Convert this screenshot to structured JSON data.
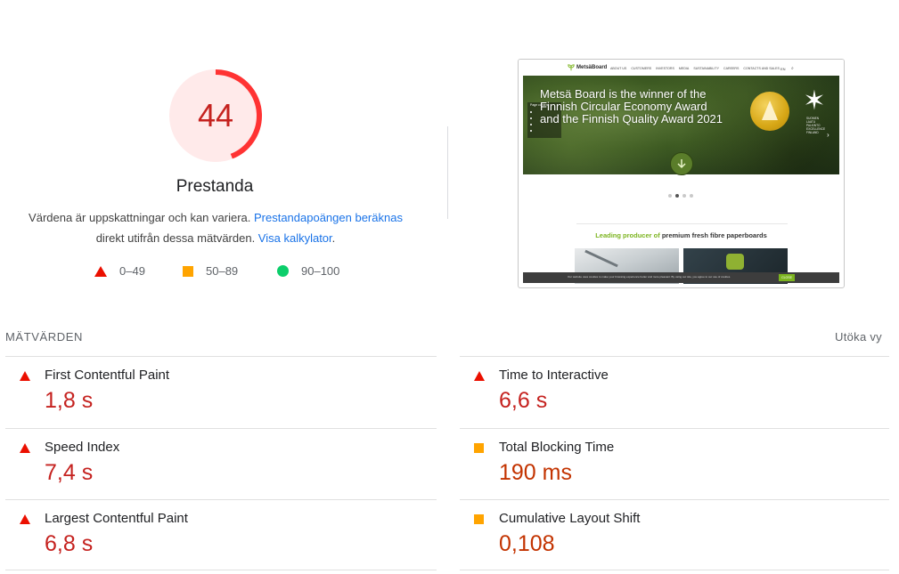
{
  "score": {
    "value": "44",
    "fraction": 0.44,
    "category": "Prestanda",
    "rating": "fail",
    "colors": {
      "fail": "#ff3333",
      "fail_bg": "#ffeaea",
      "fail_text": "#c5221f"
    }
  },
  "description": {
    "text_before": "Värdena är uppskattningar och kan variera. ",
    "link1": "Prestandapoängen beräknas",
    "text_middle": " direkt utifrån dessa mätvärden. ",
    "link2": "Visa kalkylator",
    "text_after": "."
  },
  "legend": [
    {
      "shape": "triangle",
      "label": "0–49",
      "color": "#eb0f00"
    },
    {
      "shape": "square",
      "label": "50–89",
      "color": "#ffa400"
    },
    {
      "shape": "circle",
      "label": "90–100",
      "color": "#0cce6b"
    }
  ],
  "screenshot": {
    "logo": "MetsäBoard",
    "menu": [
      "ABOUT US",
      "CUSTOMERS",
      "INVESTORS",
      "MEDIA",
      "SUSTAINABILITY",
      "CAREERS",
      "CONTACTS AND SALES"
    ],
    "lang": "EN",
    "page_content_label": "Page content",
    "headline_l1": "Metsä Board is the winner of the",
    "headline_l2": "Finnish Circular Economy Award",
    "headline_l3": "and the Finnish Quality Award 2021",
    "award_l1": "SUOMEN",
    "award_l2": "LAATU",
    "award_l3": "PALKINTO",
    "award_l4": "EXCELLENCE",
    "award_l5": "FINLAND",
    "tagline_green": "Leading producer of",
    "tagline_rest": " premium fresh fibre paperboards",
    "cookie_text": "Our website uses cookies to make your browsing experience better and more pleasant. By using our site, you agree to our use of cookies.",
    "cookie_btn": "CLOSE"
  },
  "metrics": {
    "header": "MÄTVÄRDEN",
    "expand_label": "Utöka vy",
    "items": [
      {
        "title": "First Contentful Paint",
        "value": "1,8 s",
        "rating": "fail"
      },
      {
        "title": "Time to Interactive",
        "value": "6,6 s",
        "rating": "fail"
      },
      {
        "title": "Speed Index",
        "value": "7,4 s",
        "rating": "fail"
      },
      {
        "title": "Total Blocking Time",
        "value": "190 ms",
        "rating": "average"
      },
      {
        "title": "Largest Contentful Paint",
        "value": "6,8 s",
        "rating": "fail"
      },
      {
        "title": "Cumulative Layout Shift",
        "value": "0,108",
        "rating": "average"
      }
    ]
  }
}
